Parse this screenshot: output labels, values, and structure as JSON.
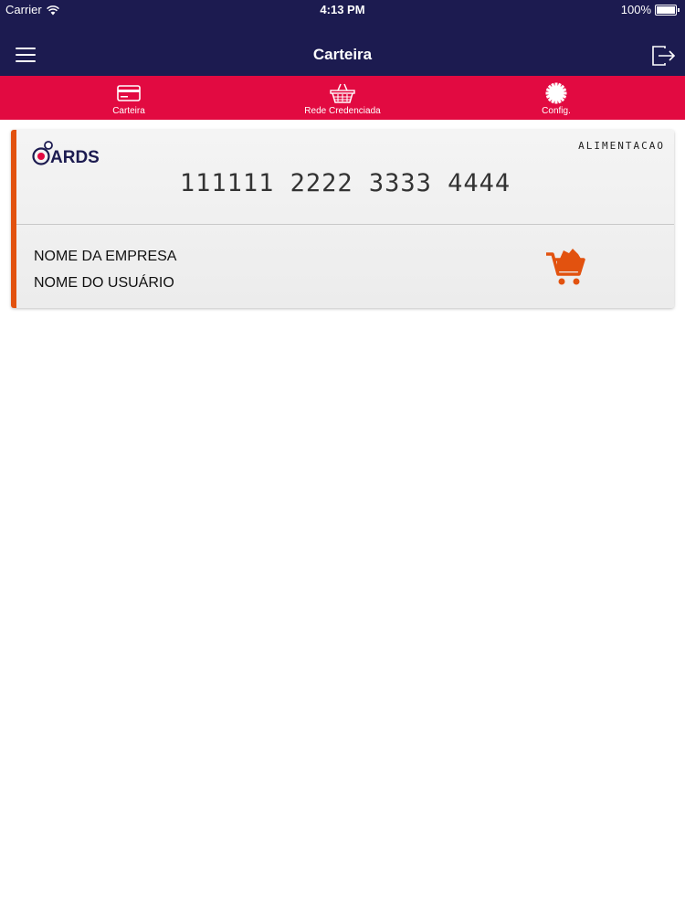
{
  "status_bar": {
    "carrier": "Carrier",
    "time": "4:13 PM",
    "battery": "100%"
  },
  "nav": {
    "title": "Carteira",
    "menu_icon": "hamburger-icon",
    "logout_icon": "logout-icon"
  },
  "tabs": [
    {
      "label": "Carteira",
      "icon": "credit-card-icon"
    },
    {
      "label": "Rede Credenciada",
      "icon": "basket-icon"
    },
    {
      "label": "Config.",
      "icon": "gear-icon"
    }
  ],
  "card": {
    "logo_text": "ARDS",
    "type": "ALIMENTACAO",
    "number": "111111 2222 3333 4444",
    "company": "NOME DA EMPRESA",
    "user": "NOME DO USUÁRIO",
    "icon": "shopping-cart-icon"
  },
  "colors": {
    "header": "#1c1b50",
    "tabbar": "#e20a41",
    "card_accent": "#e2520f",
    "logo_accent": "#e20a41"
  }
}
